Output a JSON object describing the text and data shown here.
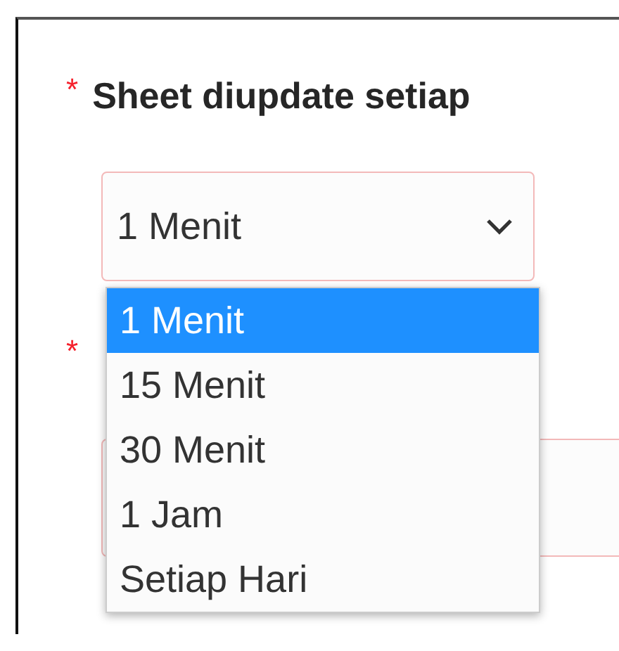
{
  "fields": [
    {
      "kind": "select",
      "required_mark": "*",
      "label": "Sheet diupdate setiap",
      "value": "1 Menit",
      "expanded": true,
      "options": [
        {
          "label": "1 Menit",
          "selected": true
        },
        {
          "label": "15 Menit",
          "selected": false
        },
        {
          "label": "30 Menit",
          "selected": false
        },
        {
          "label": "1 Jam",
          "selected": false
        },
        {
          "label": "Setiap Hari",
          "selected": false
        }
      ]
    },
    {
      "kind": "text",
      "required_mark": "*"
    }
  ]
}
